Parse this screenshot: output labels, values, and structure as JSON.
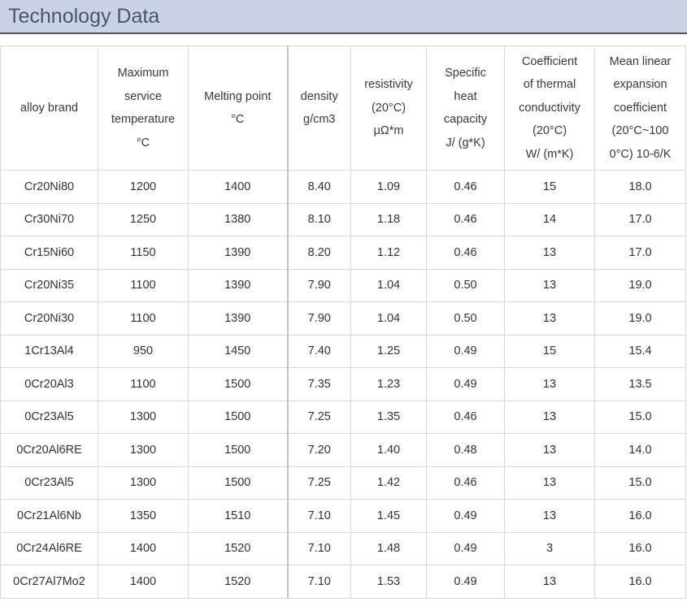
{
  "page": {
    "title": "Technology Data"
  },
  "table": {
    "headers": [
      [
        "alloy brand"
      ],
      [
        "Maximum",
        "service",
        "temperature",
        "°C"
      ],
      [
        "Melting point",
        "°C"
      ],
      [
        "density",
        "g/cm3"
      ],
      [
        "resistivity",
        "(20°C)",
        "μΩ*m"
      ],
      [
        "Specific",
        "heat",
        "capacity",
        "J/  (g*K)"
      ],
      [
        "Coefficient",
        "of thermal",
        "conductivity",
        "(20°C)",
        "W/  (m*K)"
      ],
      [
        "Mean linear",
        "expansion",
        "coefficient",
        "(20°C~100",
        "0°C)  10-6/K"
      ]
    ],
    "rows": [
      [
        "Cr20Ni80",
        "1200",
        "1400",
        "8.40",
        "1.09",
        "0.46",
        "15",
        "18.0"
      ],
      [
        "Cr30Ni70",
        "1250",
        "1380",
        "8.10",
        "1.18",
        "0.46",
        "14",
        "17.0"
      ],
      [
        "Cr15Ni60",
        "1150",
        "1390",
        "8.20",
        "1.12",
        "0.46",
        "13",
        "17.0"
      ],
      [
        "Cr20Ni35",
        "1100",
        "1390",
        "7.90",
        "1.04",
        "0.50",
        "13",
        "19.0"
      ],
      [
        "Cr20Ni30",
        "1100",
        "1390",
        "7.90",
        "1.04",
        "0.50",
        "13",
        "19.0"
      ],
      [
        "1Cr13Al4",
        "950",
        "1450",
        "7.40",
        "1.25",
        "0.49",
        "15",
        "15.4"
      ],
      [
        "0Cr20Al3",
        "1100",
        "1500",
        "7.35",
        "1.23",
        "0.49",
        "13",
        "13.5"
      ],
      [
        "0Cr23Al5",
        "1300",
        "1500",
        "7.25",
        "1.35",
        "0.46",
        "13",
        "15.0"
      ],
      [
        "0Cr20Al6RE",
        "1300",
        "1500",
        "7.20",
        "1.40",
        "0.48",
        "13",
        "14.0"
      ],
      [
        "0Cr23Al5",
        "1300",
        "1500",
        "7.25",
        "1.42",
        "0.46",
        "13",
        "15.0"
      ],
      [
        "0Cr21Al6Nb",
        "1350",
        "1510",
        "7.10",
        "1.45",
        "0.49",
        "13",
        "16.0"
      ],
      [
        "0Cr24Al6RE",
        "1400",
        "1520",
        "7.10",
        "1.48",
        "0.49",
        "3",
        "16.0"
      ],
      [
        "0Cr27Al7Mo2",
        "1400",
        "1520",
        "7.10",
        "1.53",
        "0.49",
        "13",
        "16.0"
      ]
    ]
  },
  "colors": {
    "title_bar_bg": "#c9d3e5",
    "title_text": "#4a5568",
    "grid_line": "#d8d8d8"
  }
}
